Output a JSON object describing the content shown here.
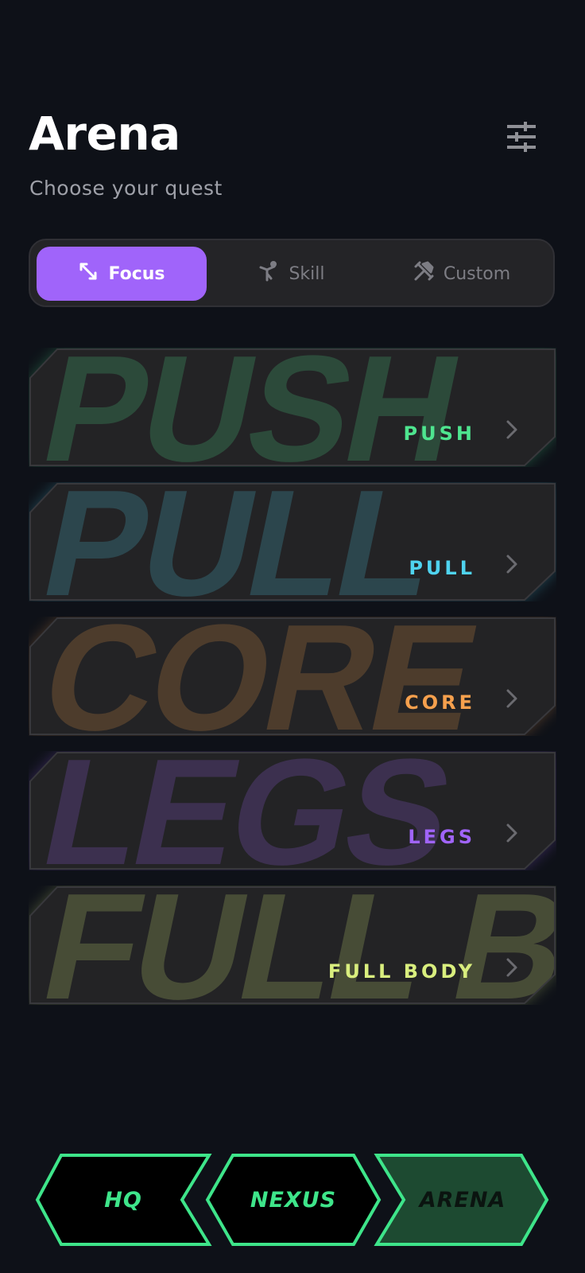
{
  "header": {
    "title": "Arena",
    "subtitle": "Choose your quest"
  },
  "icons": {
    "settings": "sliders-icon",
    "focus": "arrows-diagonal-icon",
    "skill": "figure-icon",
    "custom": "tools-icon",
    "chevron": "chevron-right-icon"
  },
  "segments": [
    {
      "label": "Focus",
      "active": true
    },
    {
      "label": "Skill",
      "active": false
    },
    {
      "label": "Custom",
      "active": false
    }
  ],
  "quests": [
    {
      "label": "PUSH",
      "bg_text": "PUSH",
      "color": "#4ee58f"
    },
    {
      "label": "PULL",
      "bg_text": "PULL",
      "color": "#4fd3ef"
    },
    {
      "label": "CORE",
      "bg_text": "CORE",
      "color": "#f6a04d"
    },
    {
      "label": "LEGS",
      "bg_text": "LEGS",
      "color": "#a064fa"
    },
    {
      "label": "FULL BODY",
      "bg_text": "FULL BO",
      "color": "#d9ee7e"
    }
  ],
  "nav": [
    {
      "label": "HQ",
      "active": false
    },
    {
      "label": "NEXUS",
      "active": false
    },
    {
      "label": "ARENA",
      "active": true
    }
  ],
  "colors": {
    "background": "#0e1118",
    "accent": "#a064fa",
    "nav_green": "#3ee58a",
    "card": "#232325"
  }
}
